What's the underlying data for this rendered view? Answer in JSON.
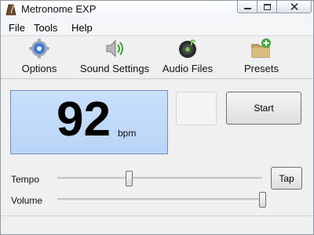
{
  "window": {
    "title": "Metronome EXP"
  },
  "menu": {
    "items": [
      "File",
      "Tools",
      "Help"
    ]
  },
  "toolbar": {
    "items": [
      {
        "label": "Options",
        "icon": "gear-icon"
      },
      {
        "label": "Sound Settings",
        "icon": "speaker-icon"
      },
      {
        "label": "Audio Files",
        "icon": "music-disc-icon"
      },
      {
        "label": "Presets",
        "icon": "folder-add-icon"
      }
    ]
  },
  "display": {
    "bpm": "92",
    "unit": "bpm"
  },
  "controls": {
    "start_label": "Start",
    "tap_label": "Tap"
  },
  "sliders": {
    "tempo": {
      "label": "Tempo",
      "level": 0.35
    },
    "volume": {
      "label": "Volume",
      "level": 1.0
    }
  },
  "colors": {
    "display_bg": "#bfd9f8",
    "display_border": "#6e8fb8"
  }
}
